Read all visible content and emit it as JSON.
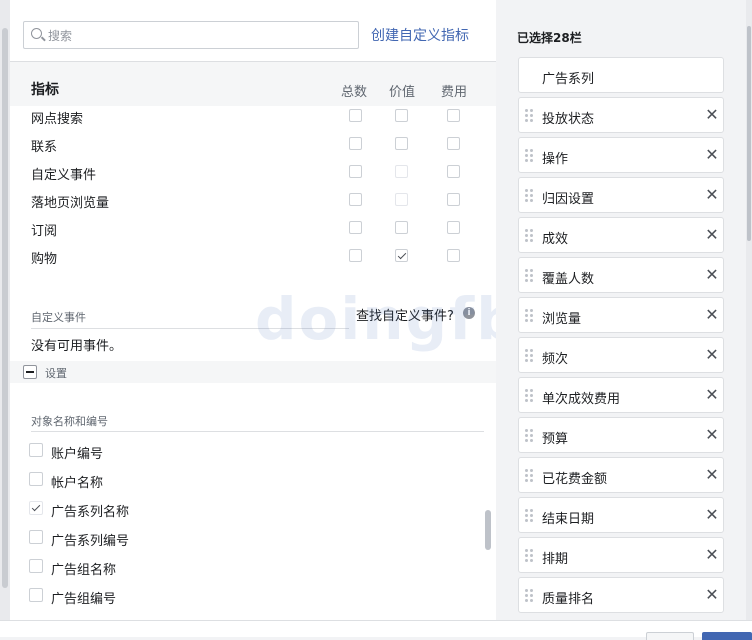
{
  "search": {
    "placeholder": "搜索"
  },
  "create_metric_link": "创建自定义指标",
  "metrics": {
    "title": "指标",
    "columns": [
      "总数",
      "价值",
      "费用"
    ],
    "rows": [
      {
        "label": "网点搜索",
        "checks": [
          false,
          false,
          false
        ],
        "faint": [
          false,
          false,
          false
        ]
      },
      {
        "label": "联系",
        "checks": [
          false,
          false,
          false
        ],
        "faint": [
          false,
          false,
          false
        ]
      },
      {
        "label": "自定义事件",
        "checks": [
          false,
          false,
          false
        ],
        "faint": [
          false,
          true,
          false
        ]
      },
      {
        "label": "落地页浏览量",
        "checks": [
          false,
          false,
          false
        ],
        "faint": [
          false,
          true,
          false
        ]
      },
      {
        "label": "订阅",
        "checks": [
          false,
          false,
          false
        ],
        "faint": [
          false,
          false,
          false
        ]
      },
      {
        "label": "购物",
        "checks": [
          false,
          true,
          false
        ],
        "faint": [
          false,
          false,
          false
        ]
      }
    ]
  },
  "custom_events": {
    "section_label": "自定义事件",
    "find_link": "查找自定义事件?",
    "info_icon_text": "i",
    "empty_text": "没有可用事件。"
  },
  "settings": {
    "label": "设置"
  },
  "object_names": {
    "section_label": "对象名称和编号",
    "items": [
      {
        "label": "账户编号",
        "checked": false,
        "disabled": false
      },
      {
        "label": "帐户名称",
        "checked": false,
        "disabled": false
      },
      {
        "label": "广告系列名称",
        "checked": true,
        "disabled": true
      },
      {
        "label": "广告系列编号",
        "checked": false,
        "disabled": false
      },
      {
        "label": "广告组名称",
        "checked": false,
        "disabled": false
      },
      {
        "label": "广告组编号",
        "checked": false,
        "disabled": false
      }
    ]
  },
  "watermark": "doingfb",
  "selected": {
    "count_label": "已选择28栏",
    "items": [
      {
        "label": "广告系列",
        "removable": false
      },
      {
        "label": "投放状态",
        "removable": true
      },
      {
        "label": "操作",
        "removable": true
      },
      {
        "label": "归因设置",
        "removable": true
      },
      {
        "label": "成效",
        "removable": true
      },
      {
        "label": "覆盖人数",
        "removable": true
      },
      {
        "label": "浏览量",
        "removable": true
      },
      {
        "label": "频次",
        "removable": true
      },
      {
        "label": "单次成效费用",
        "removable": true
      },
      {
        "label": "预算",
        "removable": true
      },
      {
        "label": "已花费金额",
        "removable": true
      },
      {
        "label": "结束日期",
        "removable": true
      },
      {
        "label": "排期",
        "removable": true
      },
      {
        "label": "质量排名",
        "removable": true
      }
    ],
    "remove_glyph": "✕"
  }
}
